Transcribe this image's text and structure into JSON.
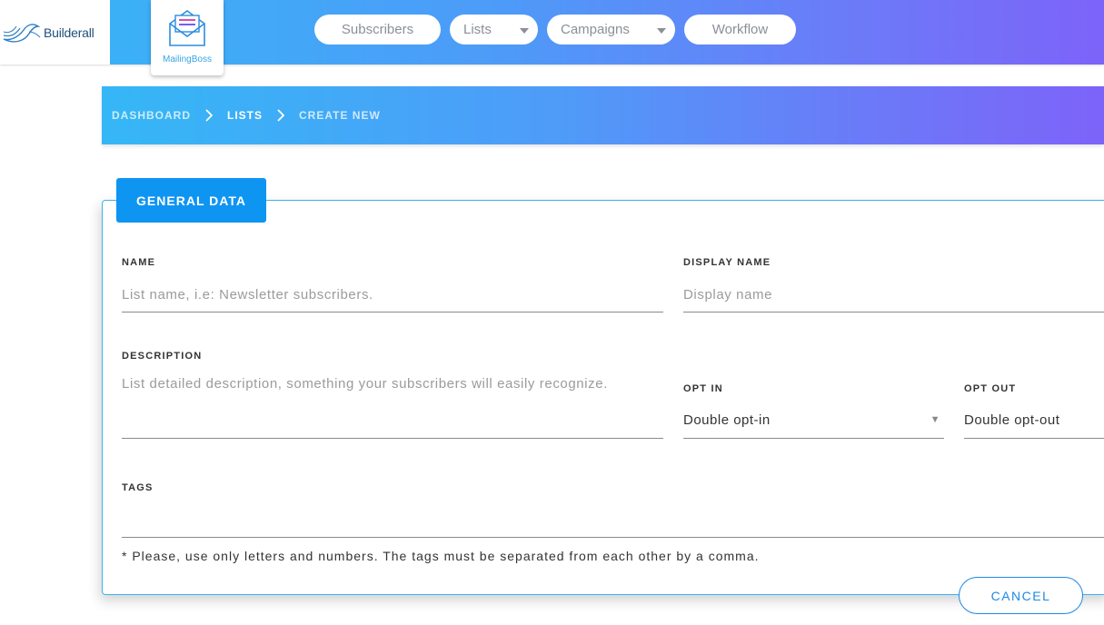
{
  "header": {
    "brand": "Builderall",
    "app_name": "MailingBoss",
    "nav": [
      {
        "label": "Subscribers",
        "has_dropdown": false
      },
      {
        "label": "Lists",
        "has_dropdown": true
      },
      {
        "label": "Campaigns",
        "has_dropdown": true
      },
      {
        "label": "Workflow",
        "has_dropdown": false
      }
    ]
  },
  "breadcrumb": [
    "DASHBOARD",
    "LISTS",
    "CREATE NEW"
  ],
  "form": {
    "tab": "GENERAL DATA",
    "name_label": "NAME",
    "name_placeholder": "List name, i.e: Newsletter subscribers.",
    "display_name_label": "DISPLAY NAME",
    "display_name_placeholder": "Display name",
    "description_label": "DESCRIPTION",
    "description_placeholder": "List detailed description, something your subscribers will easily recognize.",
    "opt_in_label": "OPT IN",
    "opt_in_value": "Double opt-in",
    "opt_out_label": "OPT OUT",
    "opt_out_value": "Double opt-out",
    "tags_label": "TAGS",
    "tags_hint": "* Please, use only letters and numbers. The tags must be separated from each other by a comma.",
    "cancel_label": "CANCEL"
  },
  "colors": {
    "gradient_start": "#35b7f6",
    "gradient_end": "#7d63f9",
    "tab_blue": "#0e95f2",
    "cancel_blue": "#1e88e5"
  }
}
